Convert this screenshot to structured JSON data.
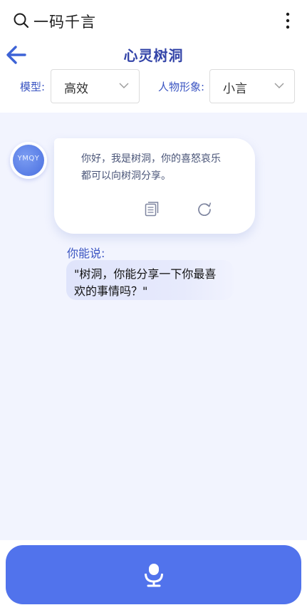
{
  "app": {
    "title": "一码千言"
  },
  "header": {
    "title": "心灵树洞"
  },
  "settings": {
    "model_label": "模型:",
    "model_value": "高效",
    "persona_label": "人物形象:",
    "persona_value": "小言"
  },
  "chat": {
    "avatar_text": "YMQY",
    "bot_message_lines": [
      "你好，我是树洞，你的喜怒哀乐",
      "都可以向树洞分享。"
    ],
    "hint_label": "你能说:",
    "hint_lines": [
      "\"树洞，你能分享一下你最喜",
      "欢的事情吗？\""
    ]
  },
  "icons": {
    "search": "search-icon",
    "more": "more-vertical-icon",
    "back": "arrow-left-icon",
    "chevron": "chevron-down-icon",
    "copy": "copy-icon",
    "refresh": "refresh-icon",
    "mic": "microphone-icon"
  },
  "colors": {
    "accent": "#3b55c2",
    "title": "#3344a8",
    "mic_button": "#5173ec",
    "chat_background": "#f2f4fe"
  }
}
